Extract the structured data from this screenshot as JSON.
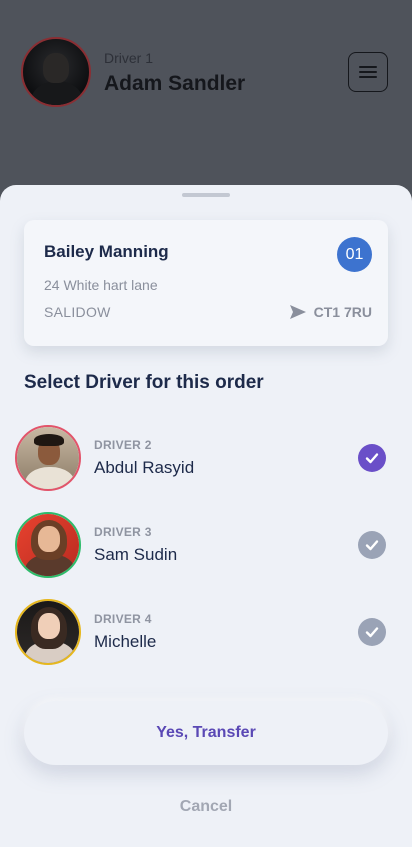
{
  "header": {
    "driver_label": "Driver 1",
    "driver_name": "Adam Sandler",
    "menu_icon": "hamburger-menu-icon"
  },
  "order": {
    "customer_name": "Bailey Manning",
    "badge": "01",
    "address": "24 White hart lane",
    "city": "SALIDOW",
    "postcode": "CT1 7RU",
    "postcode_icon": "send-arrow-icon"
  },
  "section_title": "Select Driver for this order",
  "drivers": [
    {
      "label": "DRIVER 2",
      "name": "Abdul Rasyid",
      "selected": true,
      "ring_color": "#e2546a"
    },
    {
      "label": "DRIVER 3",
      "name": "Sam Sudin",
      "selected": false,
      "ring_color": "#2dbb6a"
    },
    {
      "label": "DRIVER 4",
      "name": "Michelle",
      "selected": false,
      "ring_color": "#e6b71e"
    }
  ],
  "actions": {
    "confirm_label": "Yes, Transfer",
    "cancel_label": "Cancel"
  },
  "colors": {
    "accent": "#5a48b5",
    "check_selected": "#6a4fc8",
    "check_unselected": "#9aa3b6",
    "badge": "#3d73cf",
    "text_primary": "#1d2a4a"
  }
}
